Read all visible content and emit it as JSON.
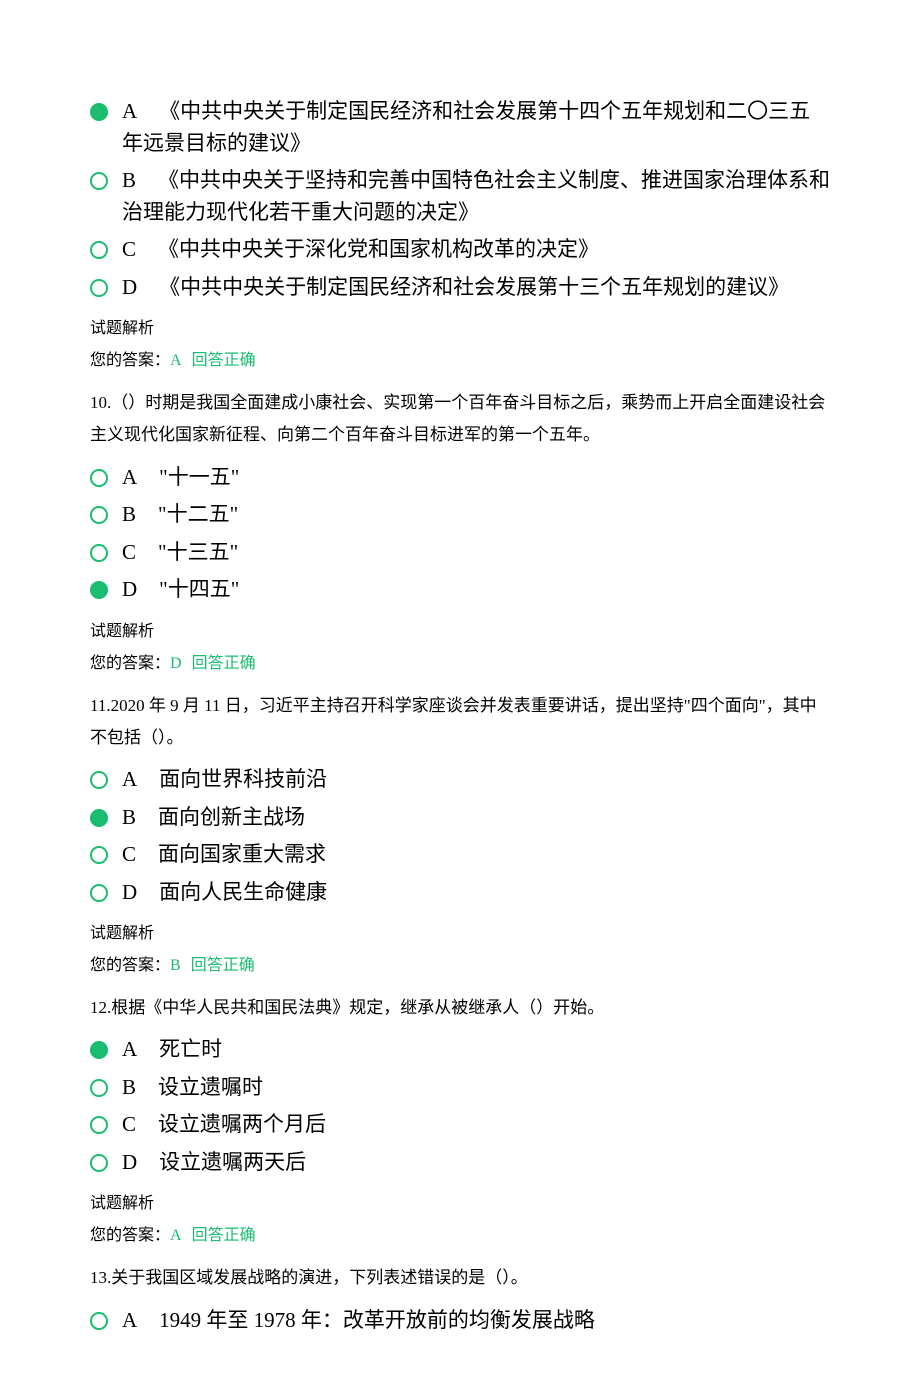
{
  "labels": {
    "analysis": "试题解析",
    "yourAnswerPrefix": "您的答案：",
    "correct": "回答正确"
  },
  "q9": {
    "optA": {
      "letter": "A",
      "text": "《中共中央关于制定国民经济和社会发展第十四个五年规划和二〇三五年远景目标的建议》"
    },
    "optB": {
      "letter": "B",
      "text": "《中共中央关于坚持和完善中国特色社会主义制度、推进国家治理体系和治理能力现代化若干重大问题的决定》"
    },
    "optC": {
      "letter": "C",
      "text": "《中共中央关于深化党和国家机构改革的决定》"
    },
    "optD": {
      "letter": "D",
      "text": "《中共中央关于制定国民经济和社会发展第十三个五年规划的建议》"
    },
    "answer": "A"
  },
  "q10": {
    "numPrefix": "10.",
    "stem": "（）时期是我国全面建成小康社会、实现第一个百年奋斗目标之后，乘势而上开启全面建设社会主义现代化国家新征程、向第二个百年奋斗目标进军的第一个五年。",
    "optA": {
      "letter": "A",
      "text": "\"十一五\""
    },
    "optB": {
      "letter": "B",
      "text": "\"十二五\""
    },
    "optC": {
      "letter": "C",
      "text": "\"十三五\""
    },
    "optD": {
      "letter": "D",
      "text": "\"十四五\""
    },
    "answer": "D"
  },
  "q11": {
    "numPrefix": "11.",
    "stemPre": "2020 年 9 月 11 日，",
    "stemPost": "习近平主持召开科学家座谈会并发表重要讲话，提出坚持\"四个面向\"，其中不包括（）。",
    "optA": {
      "letter": "A",
      "text": "面向世界科技前沿"
    },
    "optB": {
      "letter": "B",
      "text": "面向创新主战场"
    },
    "optC": {
      "letter": "C",
      "text": "面向国家重大需求"
    },
    "optD": {
      "letter": "D",
      "text": "面向人民生命健康"
    },
    "answer": "B"
  },
  "q12": {
    "numPrefix": "12.",
    "stem": "根据《中华人民共和国民法典》规定，继承从被继承人（）开始。",
    "optA": {
      "letter": "A",
      "text": "死亡时"
    },
    "optB": {
      "letter": "B",
      "text": "设立遗嘱时"
    },
    "optC": {
      "letter": "C",
      "text": "设立遗嘱两个月后"
    },
    "optD": {
      "letter": "D",
      "text": "设立遗嘱两天后"
    },
    "answer": "A"
  },
  "q13": {
    "numPrefix": "13.",
    "stem": "关于我国区域发展战略的演进，下列表述错误的是（）。",
    "optA": {
      "letter": "A",
      "textPre": "1949 年至 1978 年：",
      "textPost": "改革开放前的均衡发展战略"
    }
  }
}
